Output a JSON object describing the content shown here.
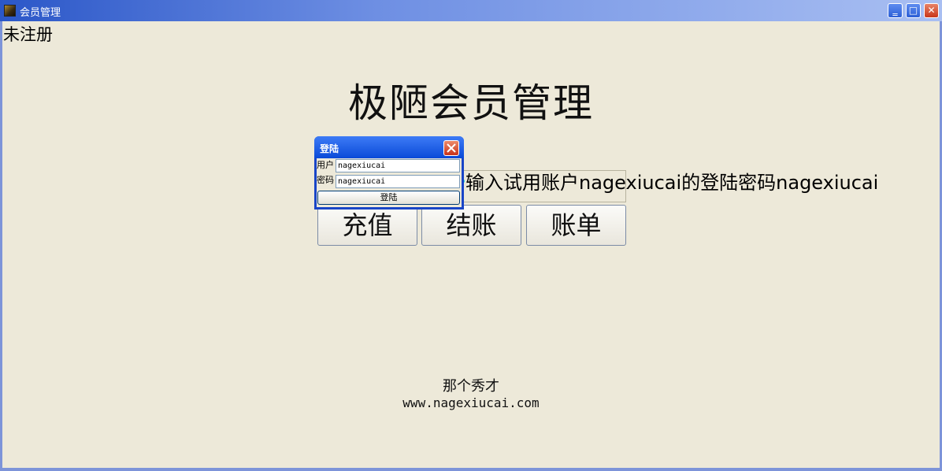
{
  "window": {
    "title": "会员管理",
    "min_glyph": "‗",
    "max_glyph": "□",
    "close_glyph": "✕"
  },
  "main": {
    "registration_status": "未注册",
    "title": "极陋会员管理",
    "hint": "输入试用账户nagexiucai的登陆密码nagexiucai",
    "buttons": {
      "recharge": "充值",
      "checkout": "结账",
      "bill": "账单"
    },
    "footer": {
      "name": "那个秀才",
      "url": "www.nagexiucai.com"
    }
  },
  "login_dialog": {
    "title": "登陆",
    "user_label": "用户",
    "password_label": "密码",
    "user_value": "nagexiucai",
    "password_value": "nagexiucai",
    "submit_label": "登陆"
  },
  "colors": {
    "background": "#ede9d9",
    "titlebar": "#2b57c8",
    "annotation_arrow": "#2ed6d2"
  }
}
